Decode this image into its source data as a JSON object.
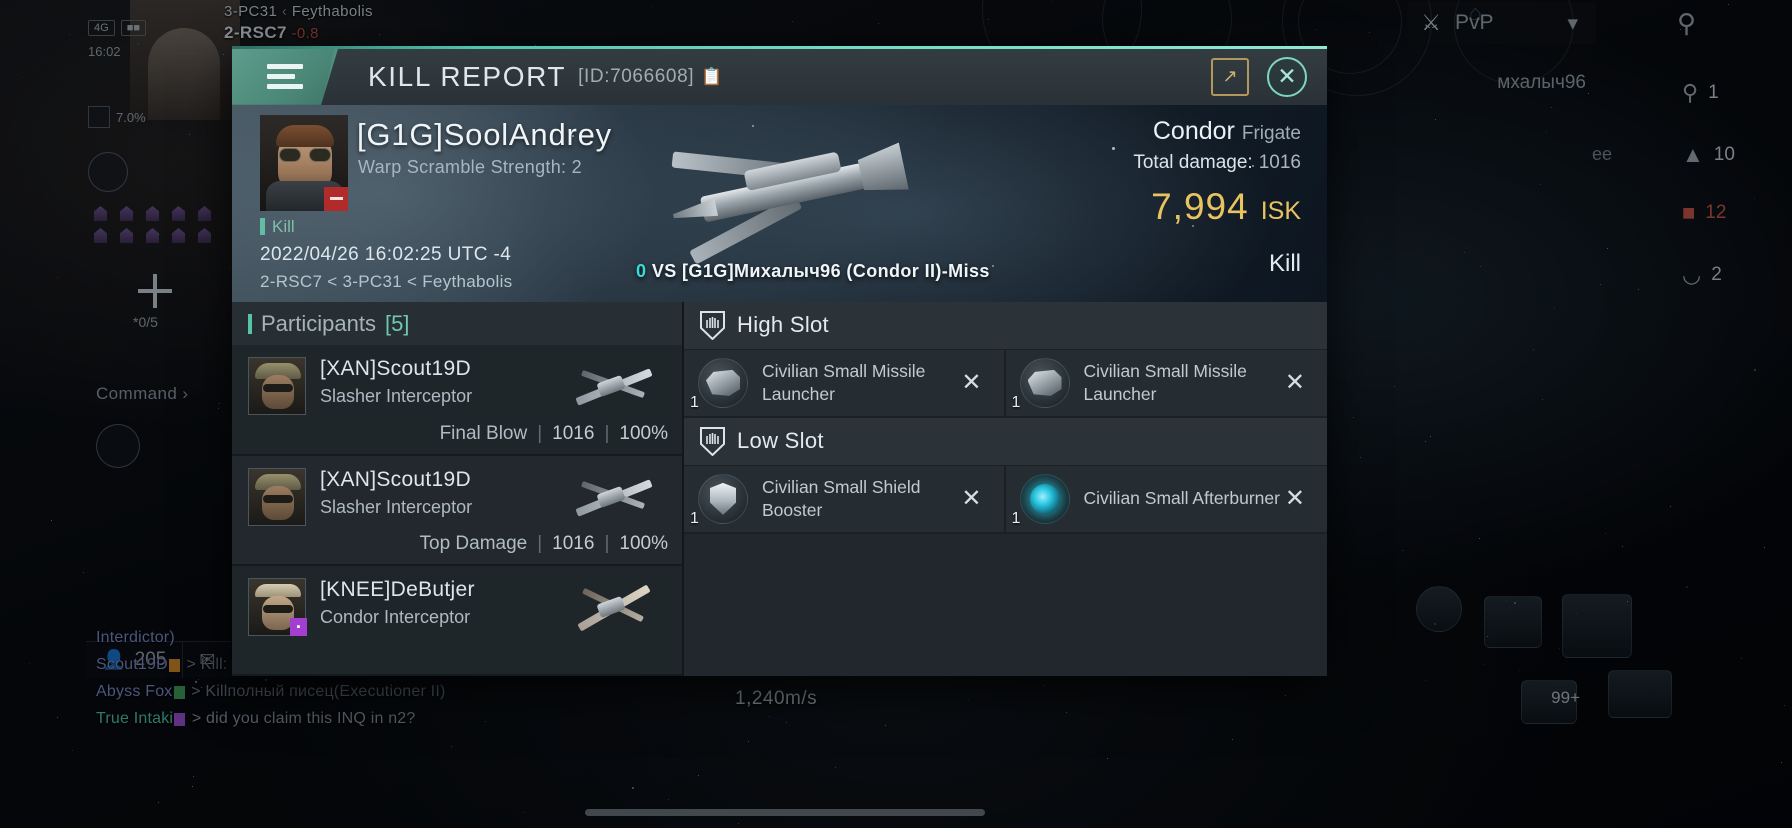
{
  "background": {
    "location": {
      "system_top": "3-PC31",
      "chevron": "‹",
      "region_top": "Feythabolis",
      "system_current": "2-RSC7",
      "security": "-0.8"
    },
    "hud": {
      "signal": "4G",
      "clock": "16:02",
      "cargo_pct": "7.0%",
      "drone_count": "*0/5",
      "command_label": "Command ›",
      "speed": "1,240m/s",
      "notif_badge": "99+",
      "member_count": "205",
      "mail_icon": "envelope-icon",
      "right_counts": [
        {
          "icon": "magnifier-icon",
          "value": "1",
          "color": "#c3cdd5"
        },
        {
          "icon": "chevron-up-icon",
          "value": "10",
          "color": "#c3cdd5"
        },
        {
          "icon": "square-icon",
          "value": "12",
          "color": "#c9564a"
        },
        {
          "icon": "arc-icon",
          "value": "2",
          "color": "#c3cdd5"
        }
      ]
    },
    "pvp_bar": {
      "swords_icon": "crossed-swords-icon",
      "label": "PvP",
      "chevron_icon": "chevron-down-icon",
      "filter_icon": "filter-icon",
      "home_icon": "home-icon"
    },
    "overlay_names": {
      "right_name": "мхалыч96",
      "right_partial": "ee"
    },
    "chat": [
      {
        "name": "Interdictor)",
        "name_class": "n-blue",
        "tag": "",
        "msg": ""
      },
      {
        "name": "Scout19D",
        "name_class": "n-blue",
        "tag": "orange",
        "msg": "> Kill:"
      },
      {
        "name": "Abyss Fox",
        "name_class": "n-blue",
        "tag": "green",
        "msg": "> Killполный писец(Executioner II)"
      },
      {
        "name": "True Intaki",
        "name_class": "n-teal",
        "tag": "purple",
        "msg": "> did you claim this INQ in n2?"
      }
    ]
  },
  "modal": {
    "header": {
      "menu_icon": "hamburger-menu-icon",
      "title": "KILL REPORT",
      "id_text": "[ID:7066608]",
      "copy_icon": "copy-icon",
      "share_icon": "share-external-icon",
      "close_icon": "close-x-icon"
    },
    "hero": {
      "victim_name": "[G1G]SoolAndrey",
      "victim_sub": "Warp Scramble Strength: 2",
      "avatar_name": "victim-avatar",
      "avatar_badge_icon": "minus-badge-icon",
      "status_label": "Kill",
      "timestamp": "2022/04/26 16:02:25 UTC -4",
      "location": "2-RSC7 < 3-PC31 < Feythabolis",
      "vs_count": "0",
      "vs_text": "VS [G1G]Михалыч96 (Condor II)-Miss",
      "ship_name": "Condor",
      "ship_class": "Frigate",
      "total_damage_label": "Total damage:",
      "total_damage_value": "1016",
      "isk_amount": "7,994",
      "isk_currency": "ISK",
      "result_label": "Kill",
      "accent_teal": "#58c3ab",
      "accent_gold": "#e9c35f"
    },
    "participants": {
      "title": "Participants",
      "count": "[5]",
      "rows": [
        {
          "name": "[XAN]Scout19D",
          "ship": "Slasher Interceptor",
          "stat_label": "Final Blow",
          "damage": "1016",
          "percent": "100%",
          "avatar": "avatar-scout19d",
          "badge": "",
          "ship_icon": "slasher-ship-icon"
        },
        {
          "name": "[XAN]Scout19D",
          "ship": "Slasher Interceptor",
          "stat_label": "Top Damage",
          "damage": "1016",
          "percent": "100%",
          "avatar": "avatar-scout19d",
          "badge": "",
          "ship_icon": "slasher-ship-icon"
        },
        {
          "name": "[KNEE]DeButjer",
          "ship": "Condor Interceptor",
          "stat_label": "",
          "damage": "",
          "percent": "",
          "avatar": "avatar-debutjer",
          "badge": "▪",
          "ship_icon": "condor-ship-icon"
        }
      ]
    },
    "fitting": {
      "sections": [
        {
          "title": "High Slot",
          "icon": "slot-shield-icon",
          "modules": [
            {
              "name": "Civilian Small Missile Launcher",
              "qty": "1",
              "icon": "missile-launcher-icon",
              "remove_icon": "remove-x-icon",
              "style": "launcher"
            },
            {
              "name": "Civilian Small Missile Launcher",
              "qty": "1",
              "icon": "missile-launcher-icon",
              "remove_icon": "remove-x-icon",
              "style": "launcher"
            }
          ]
        },
        {
          "title": "Low Slot",
          "icon": "slot-shield-icon",
          "modules": [
            {
              "name": "Civilian Small Shield Booster",
              "qty": "1",
              "icon": "shield-booster-icon",
              "remove_icon": "remove-x-icon",
              "style": "booster"
            },
            {
              "name": "Civilian Small Afterburner",
              "qty": "1",
              "icon": "afterburner-icon",
              "remove_icon": "remove-x-icon",
              "style": "afterburner"
            }
          ]
        }
      ]
    }
  }
}
